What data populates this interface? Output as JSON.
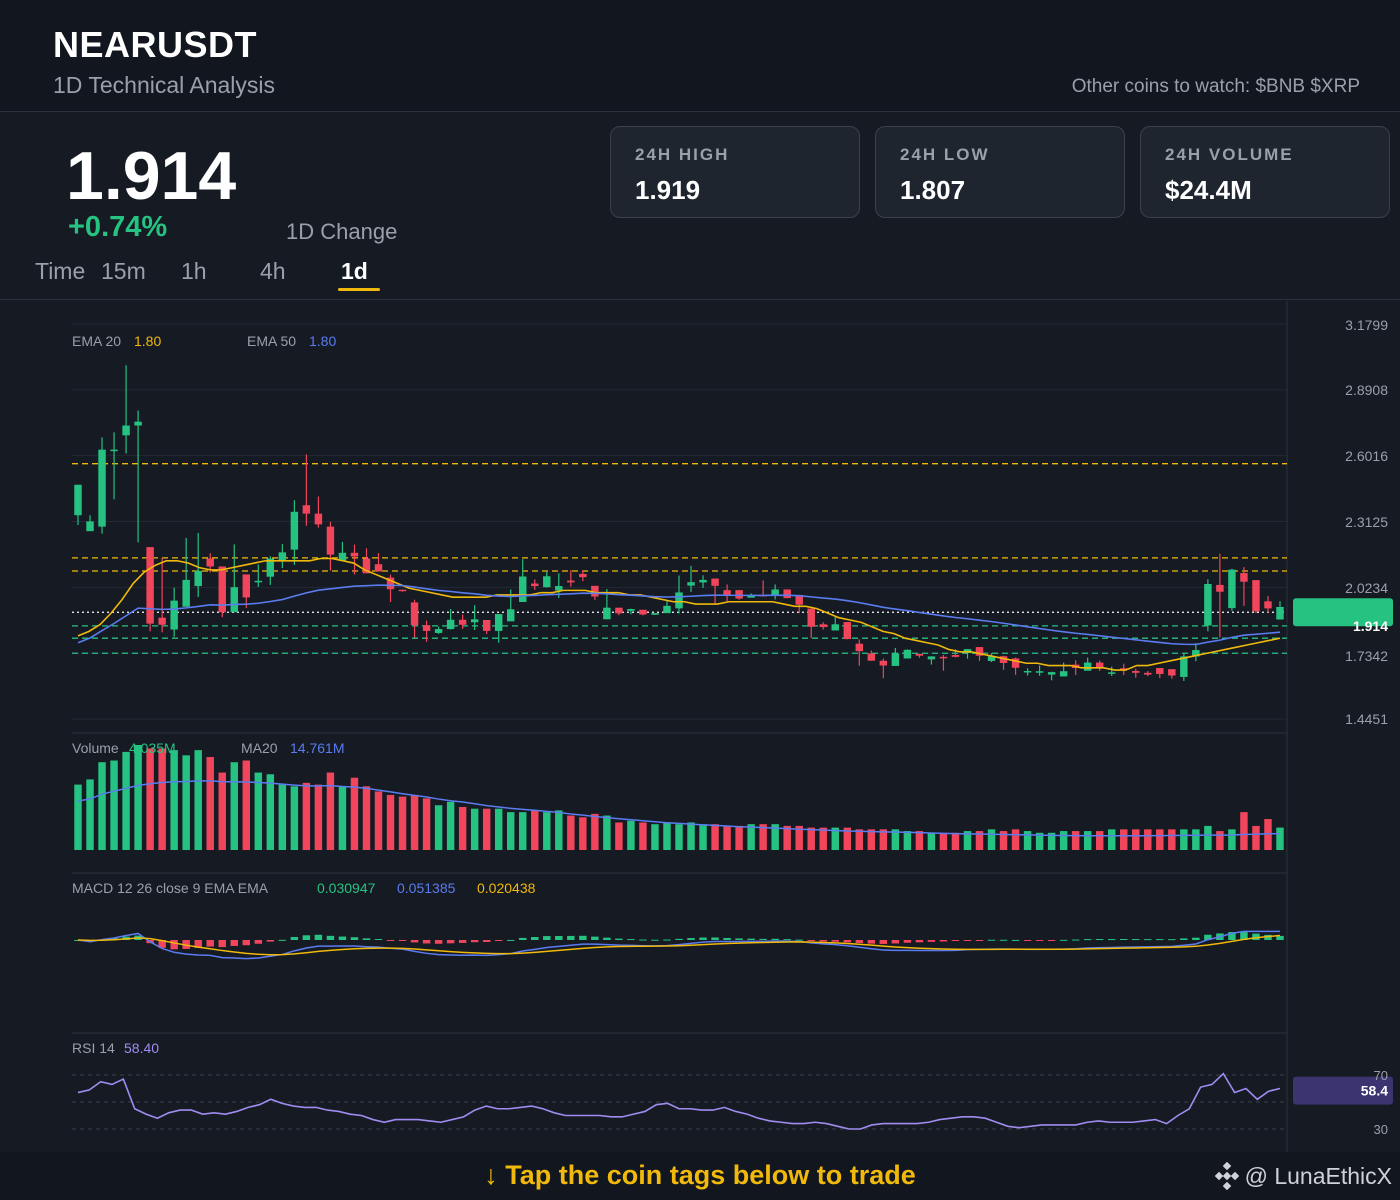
{
  "header": {
    "symbol": "NEARUSDT",
    "subtitle": "1D Technical Analysis",
    "watch": "Other coins to watch: $BNB $XRP"
  },
  "price_panel": {
    "price": "1.914",
    "change": "+0.74%",
    "change_label": "1D Change",
    "timeframe_label": "Time",
    "timeframes": [
      "15m",
      "1h",
      "4h",
      "1d"
    ],
    "active_timeframe": "1d",
    "stats": [
      {
        "label": "24H HIGH",
        "value": "1.919"
      },
      {
        "label": "24H LOW",
        "value": "1.807"
      },
      {
        "label": "24H VOLUME",
        "value": "$24.4M"
      }
    ]
  },
  "colors": {
    "up": "#26c281",
    "down": "#f0455a",
    "ema20": "#f0b90b",
    "ema50": "#5b7cf0",
    "rsi": "#a08cf0",
    "accent": "#f0b90b"
  },
  "chart_data": [
    {
      "type": "candlestick",
      "y_ticks": [
        "3.1799",
        "2.8908",
        "2.6016",
        "2.3125",
        "2.0234",
        "1.7342",
        "1.4451"
      ],
      "ylim": [
        1.4451,
        3.1799
      ],
      "last_price_tag": "1.914",
      "legend": [
        {
          "label": "EMA 20",
          "value": "1.80"
        },
        {
          "label": "EMA 50",
          "value": "1.80"
        }
      ],
      "resistance_levels": [
        2.5665,
        2.1526,
        2.0952
      ],
      "support_levels": [
        1.734,
        1.854,
        1.8
      ],
      "candles": [
        [
          2.34,
          2.474,
          2.436,
          2.297
        ],
        [
          2.27,
          2.313,
          2.34,
          2.276
        ],
        [
          2.29,
          2.628,
          2.682,
          2.259
        ],
        [
          2.628,
          2.628,
          2.704,
          2.41
        ],
        [
          2.691,
          2.734,
          2.999,
          2.611
        ],
        [
          2.734,
          2.751,
          2.8,
          2.221
        ],
        [
          2.2,
          1.864,
          1.971,
          1.83
        ],
        [
          1.89,
          1.859,
          2.152,
          1.826
        ],
        [
          1.838,
          1.965,
          2.022,
          1.806
        ],
        [
          1.938,
          2.056,
          2.24,
          1.943
        ],
        [
          2.029,
          2.096,
          2.262,
          1.981
        ],
        [
          2.15,
          2.115,
          2.173,
          2.089
        ],
        [
          2.115,
          1.914,
          1.921,
          1.892
        ],
        [
          1.914,
          2.024,
          2.212,
          1.986
        ],
        [
          2.08,
          1.979,
          2.078,
          1.932
        ],
        [
          2.05,
          2.052,
          2.124,
          2.025
        ],
        [
          2.07,
          2.15,
          2.16,
          2.034
        ],
        [
          2.14,
          2.177,
          2.213,
          2.108
        ],
        [
          2.189,
          2.355,
          2.406,
          2.122
        ],
        [
          2.384,
          2.347,
          2.607,
          2.294
        ],
        [
          2.347,
          2.3,
          2.422,
          2.286
        ],
        [
          2.29,
          2.167,
          2.311,
          2.097
        ],
        [
          2.141,
          2.175,
          2.223,
          2.149
        ],
        [
          2.175,
          2.159,
          2.211,
          2.08
        ],
        [
          2.15,
          2.085,
          2.195,
          2.085
        ],
        [
          2.125,
          2.093,
          2.174,
          2.093
        ],
        [
          2.066,
          2.015,
          2.079,
          1.959
        ],
        [
          2.013,
          2.008,
          2.01,
          2.004
        ],
        [
          1.957,
          1.857,
          1.969,
          1.803
        ],
        [
          1.857,
          1.832,
          1.877,
          1.784
        ],
        [
          1.823,
          1.84,
          1.851,
          1.819
        ],
        [
          1.84,
          1.881,
          1.928,
          1.838
        ],
        [
          1.881,
          1.859,
          1.904,
          1.841
        ],
        [
          1.87,
          1.883,
          1.945,
          1.836
        ],
        [
          1.88,
          1.832,
          1.875,
          1.818
        ],
        [
          1.832,
          1.906,
          1.906,
          1.78
        ],
        [
          1.874,
          1.927,
          2.014,
          1.903
        ],
        [
          1.959,
          2.071,
          2.147,
          2.025
        ],
        [
          2.04,
          2.029,
          2.058,
          2.012
        ],
        [
          2.024,
          2.072,
          2.091,
          2.022
        ],
        [
          2.009,
          2.029,
          2.085,
          1.977
        ],
        [
          2.053,
          2.045,
          2.099,
          2.026
        ],
        [
          2.082,
          2.068,
          2.098,
          2.05
        ],
        [
          2.03,
          1.983,
          2.019,
          1.968
        ],
        [
          1.883,
          1.934,
          2.016,
          1.904
        ],
        [
          1.934,
          1.909,
          1.916,
          1.901
        ],
        [
          1.92,
          1.928,
          1.93,
          1.905
        ],
        [
          1.925,
          1.904,
          1.904,
          1.9
        ],
        [
          1.903,
          1.91,
          1.91,
          1.902
        ],
        [
          1.91,
          1.942,
          1.964,
          1.921
        ],
        [
          1.931,
          2.001,
          2.075,
          1.908
        ],
        [
          2.031,
          2.046,
          2.118,
          2.003
        ],
        [
          2.045,
          2.056,
          2.076,
          2.021
        ],
        [
          2.062,
          2.03,
          2.059,
          1.951
        ],
        [
          2.011,
          1.985,
          2.036,
          1.963
        ],
        [
          2.011,
          1.974,
          1.978,
          1.969
        ],
        [
          1.978,
          1.99,
          1.997,
          1.983
        ],
        [
          1.99,
          1.985,
          2.054,
          1.985
        ],
        [
          1.991,
          2.014,
          2.036,
          1.97
        ],
        [
          2.014,
          1.976,
          1.999,
          1.976
        ],
        [
          1.99,
          1.947,
          1.966,
          1.91
        ],
        [
          1.93,
          1.85,
          1.912,
          1.801
        ],
        [
          1.861,
          1.849,
          1.87,
          1.838
        ],
        [
          1.834,
          1.861,
          1.893,
          1.834
        ],
        [
          1.871,
          1.796,
          1.868,
          1.795
        ],
        [
          1.776,
          1.743,
          1.795,
          1.679
        ],
        [
          1.733,
          1.701,
          1.746,
          1.701
        ],
        [
          1.701,
          1.68,
          1.711,
          1.624
        ],
        [
          1.678,
          1.733,
          1.757,
          1.687
        ],
        [
          1.711,
          1.749,
          1.751,
          1.727
        ],
        [
          1.731,
          1.723,
          1.732,
          1.714
        ],
        [
          1.707,
          1.72,
          1.721,
          1.684
        ],
        [
          1.718,
          1.713,
          1.726,
          1.657
        ],
        [
          1.726,
          1.718,
          1.751,
          1.716
        ],
        [
          1.735,
          1.752,
          1.752,
          1.71
        ],
        [
          1.761,
          1.723,
          1.761,
          1.7
        ],
        [
          1.7,
          1.721,
          1.734,
          1.695
        ],
        [
          1.721,
          1.691,
          1.723,
          1.661
        ],
        [
          1.711,
          1.67,
          1.715,
          1.639
        ],
        [
          1.65,
          1.656,
          1.668,
          1.636
        ],
        [
          1.65,
          1.655,
          1.68,
          1.635
        ],
        [
          1.64,
          1.651,
          1.653,
          1.615
        ],
        [
          1.632,
          1.655,
          1.693,
          1.633
        ],
        [
          1.684,
          1.669,
          1.703,
          1.638
        ],
        [
          1.657,
          1.693,
          1.715,
          1.678
        ],
        [
          1.693,
          1.667,
          1.702,
          1.656
        ],
        [
          1.648,
          1.65,
          1.675,
          1.634
        ],
        [
          1.668,
          1.66,
          1.688,
          1.638
        ],
        [
          1.656,
          1.648,
          1.666,
          1.627
        ],
        [
          1.648,
          1.64,
          1.656,
          1.633
        ],
        [
          1.669,
          1.643,
          1.669,
          1.625
        ],
        [
          1.664,
          1.636,
          1.664,
          1.622
        ],
        [
          1.63,
          1.72,
          1.735,
          1.612
        ],
        [
          1.72,
          1.748,
          1.778,
          1.699
        ],
        [
          1.856,
          2.038,
          2.059,
          1.83
        ],
        [
          2.034,
          2.004,
          2.171,
          1.803
        ],
        [
          1.932,
          2.101,
          2.105,
          1.92
        ],
        [
          2.086,
          2.048,
          2.112,
          1.942
        ],
        [
          2.055,
          1.918,
          1.987,
          1.91
        ],
        [
          1.962,
          1.931,
          1.986,
          1.91
        ],
        [
          1.882,
          1.937,
          1.962,
          1.928
        ]
      ],
      "ema20_values": [
        1.81,
        1.83,
        1.86,
        1.91,
        1.97,
        2.04,
        2.09,
        2.12,
        2.14,
        2.14,
        2.13,
        2.11,
        2.1,
        2.1,
        2.11,
        2.12,
        2.13,
        2.14,
        2.14,
        2.14,
        2.14,
        2.14,
        2.15,
        2.15,
        2.14,
        2.13,
        2.1,
        2.08,
        2.06,
        2.04,
        2.02,
        2.01,
        2.0,
        1.99,
        1.98,
        1.98,
        1.98,
        1.98,
        1.99,
        1.99,
        1.99,
        1.99,
        2.0,
        2.0,
        2.01,
        2.01,
        2.01,
        2.0,
        2.0,
        2.0,
        1.99,
        1.99,
        1.98,
        1.97,
        1.96,
        1.96,
        1.95,
        1.95,
        1.95,
        1.96,
        1.96,
        1.96,
        1.96,
        1.96,
        1.95,
        1.94,
        1.94,
        1.93,
        1.91,
        1.89,
        1.88,
        1.87,
        1.85,
        1.83,
        1.82,
        1.8,
        1.79,
        1.78,
        1.77,
        1.75,
        1.74,
        1.74,
        1.73,
        1.72,
        1.71,
        1.7,
        1.69,
        1.69,
        1.68,
        1.68,
        1.68,
        1.67,
        1.67,
        1.67,
        1.66,
        1.66,
        1.68,
        1.68,
        1.69,
        1.7,
        1.71,
        1.72,
        1.73,
        1.74,
        1.75,
        1.76,
        1.77,
        1.78,
        1.79,
        1.8
      ]
    },
    {
      "type": "bar",
      "legend": [
        {
          "label": "Volume",
          "value": "4.035M"
        },
        {
          "label": "MA20",
          "value": "14.761M"
        }
      ],
      "values": [
        38,
        41,
        51,
        52,
        57,
        61,
        59,
        59,
        58,
        55,
        58,
        54,
        45,
        51,
        52,
        45,
        44,
        38,
        37,
        39,
        38,
        45,
        37,
        42,
        37,
        34,
        32,
        31,
        32,
        30,
        26,
        28,
        25,
        24,
        24,
        24,
        22,
        22,
        23,
        22,
        23,
        20,
        19,
        21,
        20,
        16,
        17,
        16,
        15,
        16,
        15,
        16,
        15,
        15,
        14,
        14,
        15,
        15,
        15,
        14,
        14,
        13,
        13,
        13,
        13,
        12,
        12,
        12,
        12,
        11,
        11,
        10,
        10,
        10,
        11,
        11,
        12,
        11,
        12,
        11,
        10,
        10,
        11,
        11,
        11,
        11,
        12,
        12,
        12,
        12,
        12,
        12,
        12,
        12,
        14,
        11,
        12,
        22,
        14,
        18,
        13,
        13,
        10
      ]
    },
    {
      "type": "bar",
      "legend": [
        {
          "label": "MACD 12 26 close 9 EMA EMA",
          "value": ""
        },
        {
          "label": "",
          "value": "0.030947"
        },
        {
          "label": "",
          "value": "0.051385"
        },
        {
          "label": "",
          "value": "0.020438"
        }
      ]
    },
    {
      "type": "line",
      "legend": [
        {
          "label": "RSI 14",
          "value": "58.40"
        }
      ],
      "levels": [
        70,
        50,
        30
      ],
      "level_labels": [
        "70",
        "30"
      ],
      "last_value_tag": "58.4",
      "values": [
        57,
        59,
        65,
        63,
        67,
        45,
        41,
        38,
        42,
        44,
        44,
        41,
        42,
        41,
        43,
        46,
        48,
        52,
        49,
        47,
        46,
        46,
        44,
        43,
        41,
        40,
        37,
        35,
        37,
        37,
        37,
        36,
        35,
        37,
        39,
        44,
        47,
        45,
        45,
        46,
        47,
        45,
        42,
        40,
        40,
        40,
        40,
        39,
        39,
        41,
        43,
        48,
        49,
        45,
        45,
        44,
        44,
        46,
        43,
        41,
        38,
        36,
        35,
        34,
        34,
        35,
        34,
        32,
        30,
        30,
        33,
        34,
        34,
        34,
        34,
        35,
        37,
        38,
        39,
        39,
        38,
        35,
        32,
        31,
        32,
        33,
        33,
        33,
        33,
        35,
        36,
        35,
        35,
        35,
        36,
        37,
        34,
        40,
        45,
        61,
        63,
        71,
        57,
        60,
        52,
        58,
        60
      ]
    }
  ],
  "footer": {
    "cta": "↓ Tap the coin tags below to trade",
    "brand": "@ LunaEthicX"
  }
}
